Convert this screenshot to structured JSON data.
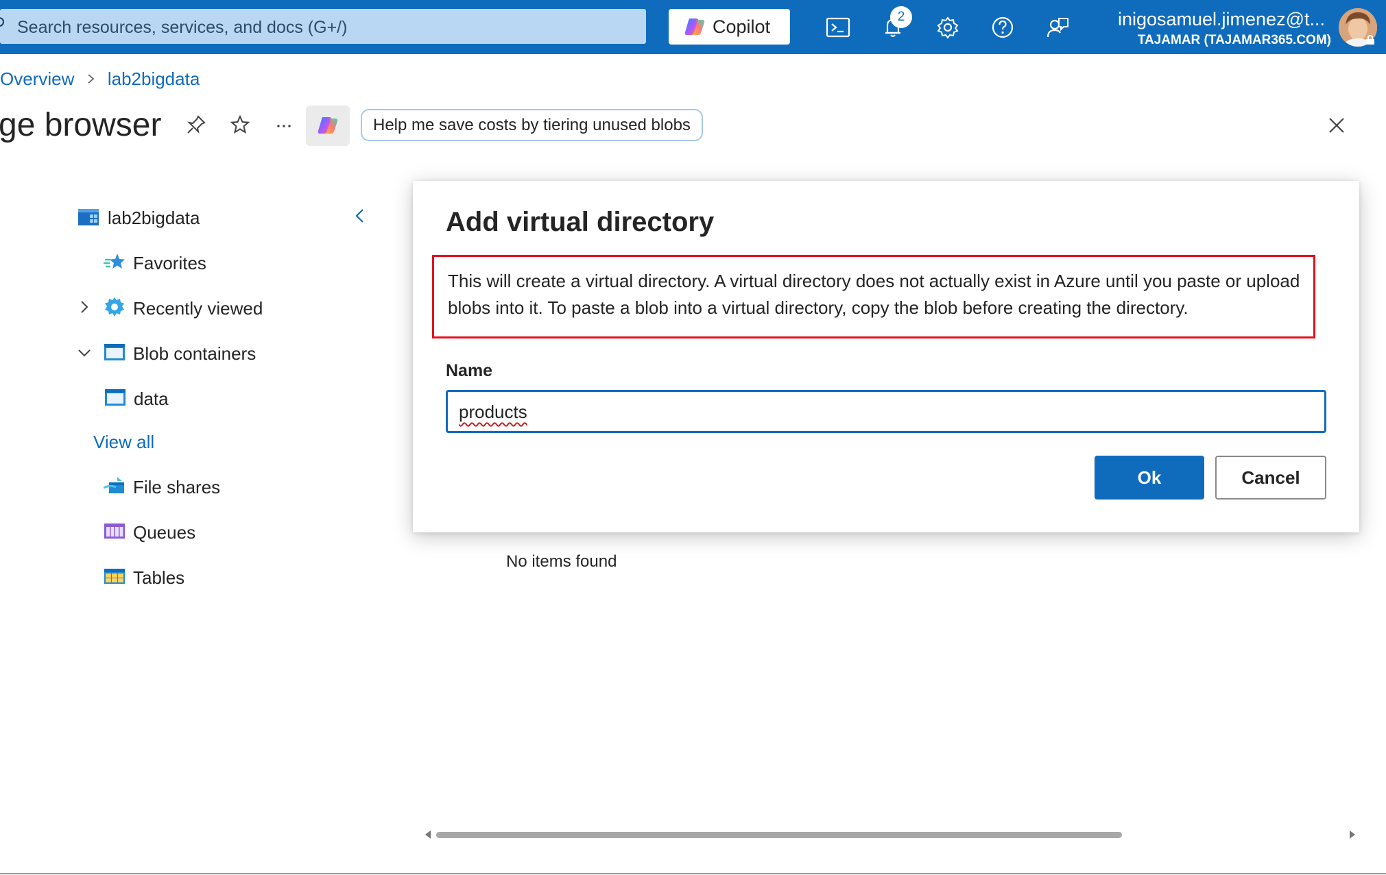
{
  "topbar": {
    "search_placeholder": "Search resources, services, and docs (G+/)",
    "copilot_label": "Copilot",
    "notification_count": "2",
    "user_email": "inigosamuel.jimenez@t...",
    "user_tenant": "TAJAMAR (TAJAMAR365.COM)"
  },
  "breadcrumb": {
    "items": [
      "Overview",
      "lab2bigdata"
    ]
  },
  "header": {
    "title": "ge browser",
    "suggestion": "Help me save costs by tiering unused blobs"
  },
  "tree": {
    "root": "lab2bigdata",
    "favorites": "Favorites",
    "recently_viewed": "Recently viewed",
    "blob_containers": "Blob containers",
    "data": "data",
    "view_all": "View all",
    "file_shares": "File shares",
    "queues": "Queues",
    "tables": "Tables"
  },
  "content": {
    "empty_text": "No items found"
  },
  "dialog": {
    "title": "Add virtual directory",
    "info": "This will create a virtual directory. A virtual directory does not actually exist in Azure until you paste or upload blobs into it. To paste a blob into a virtual directory, copy the blob before creating the directory.",
    "name_label": "Name",
    "name_value": "products",
    "ok_label": "Ok",
    "cancel_label": "Cancel"
  },
  "colors": {
    "azure_blue": "#0f6cbd",
    "highlight_red": "#e0101c"
  },
  "icons": [
    "search-icon",
    "copilot-icon",
    "cloud-shell-icon",
    "bell-icon",
    "gear-icon",
    "help-icon",
    "feedback-icon",
    "pin-icon",
    "star-icon",
    "more-icon",
    "close-icon",
    "storage-account-icon",
    "favorites-icon",
    "recent-gear-icon",
    "container-icon",
    "file-share-icon",
    "queue-icon",
    "table-icon",
    "chevron-left-icon",
    "chevron-right-icon",
    "chevron-down-icon"
  ]
}
